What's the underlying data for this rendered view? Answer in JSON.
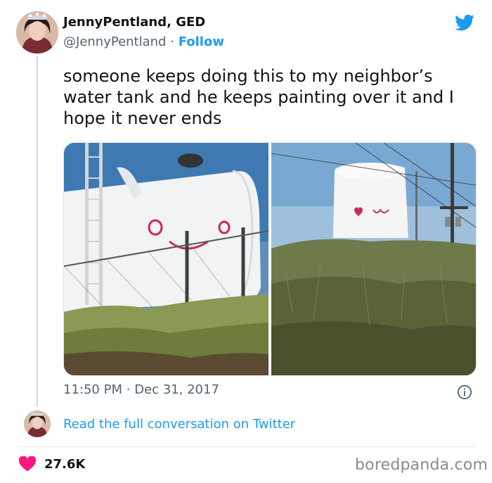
{
  "author": {
    "display_name": "JennyPentland, GED",
    "handle": "@JennyPentland",
    "separator": "·",
    "follow_label": "Follow"
  },
  "tweet": {
    "text": "someone keeps doing this to my neighbor’s water tank and he keeps painting over it and I hope it never ends",
    "time": "11:50 PM",
    "date_separator": "·",
    "date": "Dec 31, 2017"
  },
  "reply": {
    "link_text": "Read the full conversation on Twitter"
  },
  "stats": {
    "likes": "27.6K"
  },
  "watermark": {
    "text": "boredpanda.com"
  },
  "icons": {
    "brand": "twitter-bird-icon",
    "info": "info-icon",
    "like": "heart-icon"
  },
  "colors": {
    "link": "#1d9bf0",
    "heart": "#f91880",
    "muted_text": "#536471"
  }
}
